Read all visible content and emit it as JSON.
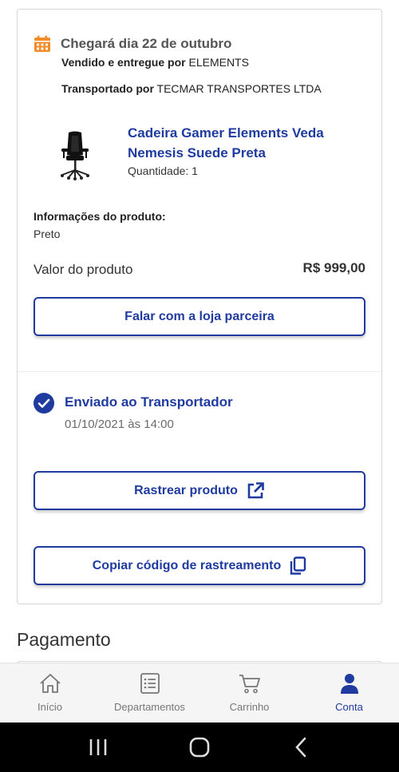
{
  "delivery": {
    "title": "Chegará dia 22 de outubro",
    "sold_prefix": "Vendido e entregue por",
    "seller": "ELEMENTS",
    "shipped_prefix": "Transportado por",
    "carrier": "TECMAR TRANSPORTES LTDA"
  },
  "product": {
    "name": "Cadeira Gamer Elements Veda Nemesis Suede Preta",
    "quantity": "Quantidade: 1",
    "info_title": "Informações do produto:",
    "info_value": "Preto",
    "value_label": "Valor do produto",
    "value_amount": "R$ 999,00"
  },
  "buttons": {
    "contact": "Falar com a loja parceira",
    "track": "Rastrear produto",
    "copy": "Copiar código de rastreamento"
  },
  "status": {
    "title": "Enviado ao Transportador",
    "date": "01/10/2021 às 14:00"
  },
  "payment": {
    "title": "Pagamento"
  },
  "nav": {
    "items": [
      {
        "label": "Início",
        "icon": "home-icon"
      },
      {
        "label": "Departamentos",
        "icon": "list-icon"
      },
      {
        "label": "Carrinho",
        "icon": "cart-icon"
      },
      {
        "label": "Conta",
        "icon": "user-icon",
        "active": true
      }
    ]
  },
  "colors": {
    "brand": "#1f3ba0",
    "calendar": "#f28c28"
  }
}
